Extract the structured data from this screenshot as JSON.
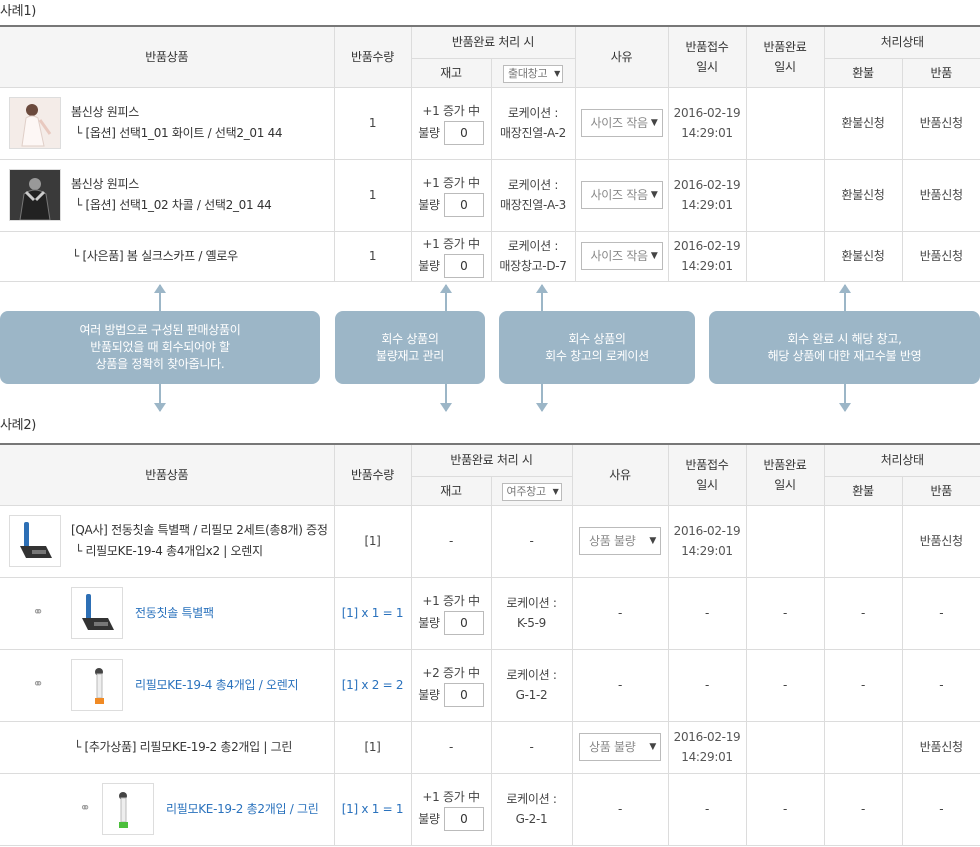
{
  "example1_label": "사례1)",
  "example2_label": "사례2)",
  "headers": {
    "product": "반품상품",
    "qty": "반품수량",
    "complete_processing": "반품완료 처리 시",
    "stock": "재고",
    "reason": "사유",
    "received_time": "반품접수\n일시",
    "completed_time": "반품완료\n일시",
    "status": "처리상태",
    "refund": "환불",
    "return": "반품"
  },
  "table1": {
    "warehouse_select": "출대창고",
    "rows": [
      {
        "thumb_icon": "dress-photo-icon",
        "name": "봄신상 원피스",
        "option": "└ [옵션] 선택1_01 화이트 / 선택2_01 44",
        "qty": "1",
        "stock_increase": "+1 증가 中",
        "defect_label": "불량",
        "defect_value": "0",
        "location_label": "로케이션 :",
        "location": "매장진열-A-2",
        "reason": "사이즈 작음",
        "date": "2016-02-19",
        "time": "14:29:01",
        "refund": "환불신청",
        "return": "반품신청"
      },
      {
        "thumb_icon": "dress-photo-icon",
        "name": "봄신상 원피스",
        "option": "└ [옵션] 선택1_02 차콜 / 선택2_01 44",
        "qty": "1",
        "stock_increase": "+1 증가 中",
        "defect_label": "불량",
        "defect_value": "0",
        "location_label": "로케이션 :",
        "location": "매장진열-A-3",
        "reason": "사이즈 작음",
        "date": "2016-02-19",
        "time": "14:29:01",
        "refund": "환불신청",
        "return": "반품신청"
      },
      {
        "name": "└ [사은품] 봄 실크스카프 / 옐로우",
        "qty": "1",
        "stock_increase": "+1 증가 中",
        "defect_label": "불량",
        "defect_value": "0",
        "location_label": "로케이션 :",
        "location": "매장창고-D-7",
        "reason": "사이즈 작음",
        "date": "2016-02-19",
        "time": "14:29:01",
        "refund": "환불신청",
        "return": "반품신청"
      }
    ]
  },
  "callouts": [
    "여러 방법으로 구성된 판매상품이\n반품되었을 때 회수되어야 할\n상품을 정확히 찾아줍니다.",
    "회수 상품의\n불량재고 관리",
    "회수 상품의\n회수 창고의 로케이션",
    "회수 완료 시 해당 창고,\n해당 상품에 대한 재고수불 반영"
  ],
  "table2": {
    "warehouse_select": "여주창고",
    "rows": [
      {
        "type": "main",
        "name": "[QA사] 전동칫솔 특별팩 / 리필모 2세트(총8개) 증정",
        "option": "└ 리필모KE-19-4 총4개입x2 | 오렌지",
        "qty": "[1]",
        "stock": "-",
        "location": "-",
        "reason": "상품 불량",
        "date": "2016-02-19",
        "time": "14:29:01",
        "refund": "",
        "return": "반품신청"
      },
      {
        "type": "sub",
        "name": "전동칫솔 특별팩",
        "qty": "[1] x 1 = 1",
        "stock_increase": "+1 증가 中",
        "defect_label": "불량",
        "defect_value": "0",
        "location_label": "로케이션 :",
        "location": "K-5-9",
        "reason": "-",
        "date": "-",
        "completed": "-",
        "refund": "-",
        "return": "-"
      },
      {
        "type": "sub",
        "name": "리필모KE-19-4 총4개입 / 오렌지",
        "qty": "[1] x 2 = 2",
        "stock_increase": "+2 증가 中",
        "defect_label": "불량",
        "defect_value": "0",
        "location_label": "로케이션 :",
        "location": "G-1-2",
        "reason": "-",
        "date": "-",
        "completed": "-",
        "refund": "-",
        "return": "-"
      },
      {
        "type": "addon",
        "name": "└ [추가상품] 리필모KE-19-2 총2개입 | 그린",
        "qty": "[1]",
        "stock": "-",
        "location": "-",
        "reason": "상품 불량",
        "date": "2016-02-19",
        "time": "14:29:01",
        "refund": "",
        "return": "반품신청"
      },
      {
        "type": "sub2",
        "name": "리필모KE-19-2 총2개입 / 그린",
        "qty": "[1] x 1 = 1",
        "stock_increase": "+1 증가 中",
        "defect_label": "불량",
        "defect_value": "0",
        "location_label": "로케이션 :",
        "location": "G-2-1",
        "reason": "-",
        "date": "-",
        "completed": "-",
        "refund": "-",
        "return": "-"
      }
    ]
  },
  "colors": {
    "callout": "#9cb6c7",
    "link": "#2a72bd",
    "header_bg": "#f5f5f5"
  }
}
